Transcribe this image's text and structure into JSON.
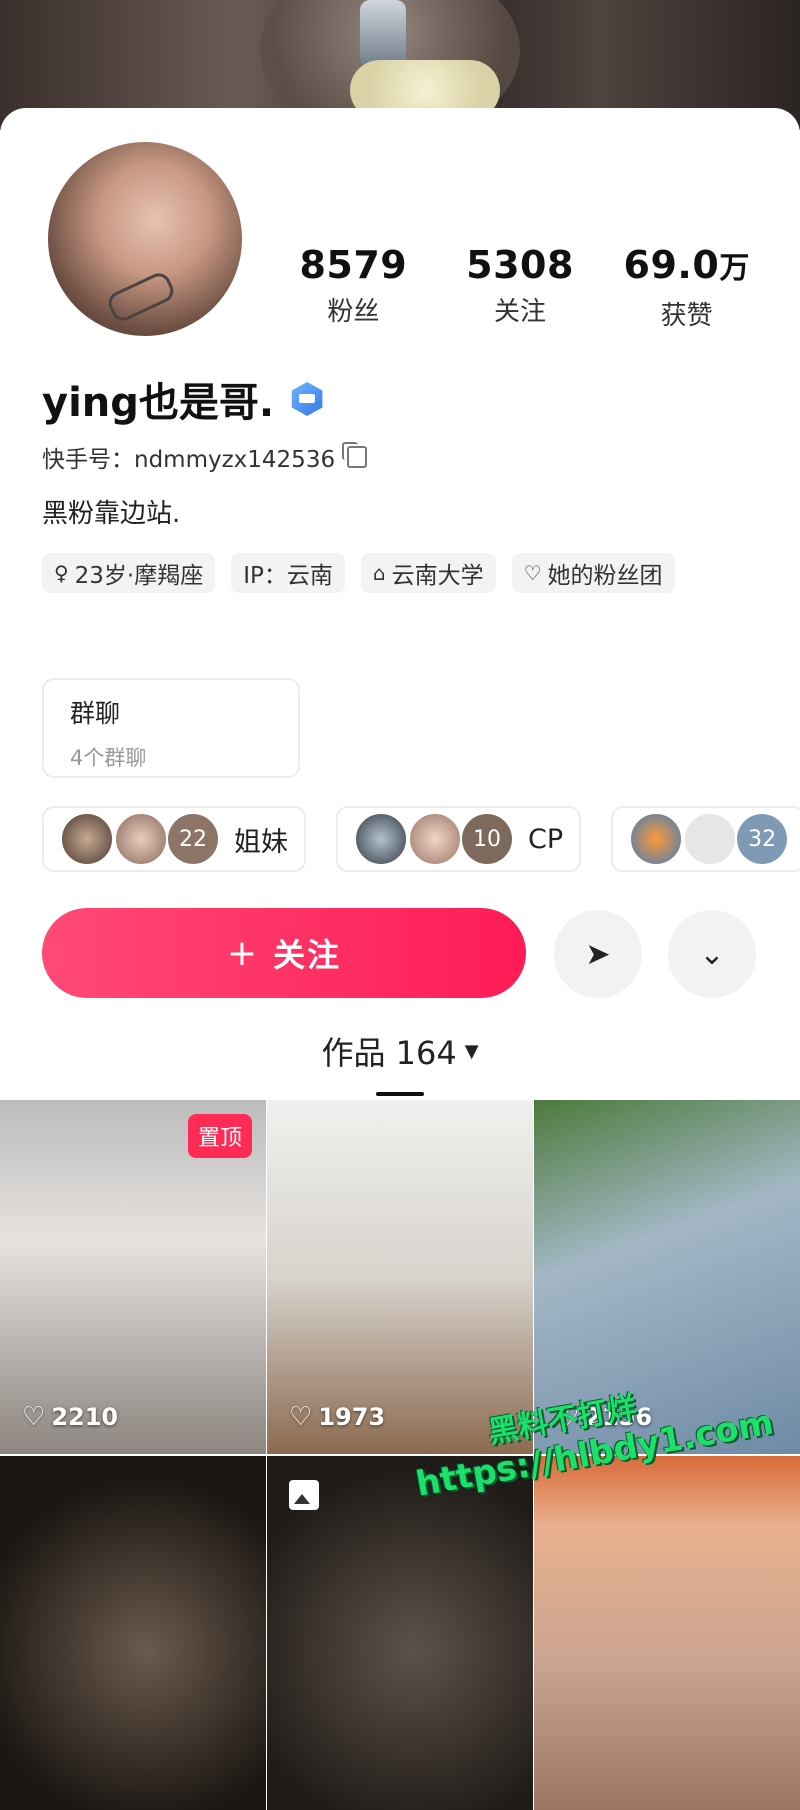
{
  "profile": {
    "name": "ying也是哥.",
    "kuaishou_id": "快手号：ndmmyzx142536",
    "bio": "黑粉靠边站."
  },
  "stats": [
    {
      "num": "8579",
      "unit": "",
      "label": "粉丝"
    },
    {
      "num": "5308",
      "unit": "",
      "label": "关注"
    },
    {
      "num": "69.0",
      "unit": "万",
      "label": "获赞"
    }
  ],
  "tags": {
    "age": "23岁·摩羯座",
    "ip": "IP：云南",
    "school": "云南大学",
    "fanclub": "她的粉丝团"
  },
  "group": {
    "title": "群聊",
    "sub": "4个群聊"
  },
  "circles": [
    {
      "count": "22",
      "label": "姐妹"
    },
    {
      "count": "10",
      "label": "CP"
    },
    {
      "count": "32",
      "label": ""
    }
  ],
  "actions": {
    "follow": "关注",
    "plus": "+"
  },
  "tab": {
    "label": "作品 164"
  },
  "videos": [
    {
      "likes": "2210",
      "pinned": "置顶"
    },
    {
      "likes": "1973"
    },
    {
      "likes": "2156"
    }
  ],
  "watermark": {
    "line1": "黑料不打烊",
    "line2": "https://hlbdy1.com"
  }
}
